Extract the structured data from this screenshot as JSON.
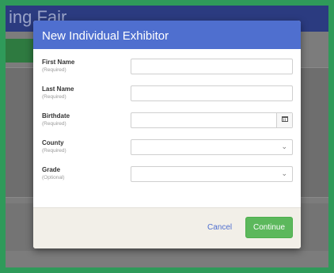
{
  "background": {
    "title_fragment": "ing Fair"
  },
  "modal": {
    "title": "New Individual Exhibitor",
    "fields": [
      {
        "label": "First Name",
        "note": "(Required)",
        "type": "text",
        "value": ""
      },
      {
        "label": "Last Name",
        "note": "(Required)",
        "type": "text",
        "value": ""
      },
      {
        "label": "Birthdate",
        "note": "(Required)",
        "type": "date",
        "value": ""
      },
      {
        "label": "County",
        "note": "(Required)",
        "type": "select",
        "value": ""
      },
      {
        "label": "Grade",
        "note": "(Optional)",
        "type": "select",
        "value": ""
      }
    ],
    "footer": {
      "cancel_label": "Cancel",
      "continue_label": "Continue"
    }
  },
  "icons": {
    "calendar": "calendar-icon",
    "chevron": "chevron-down-icon"
  },
  "colors": {
    "frame": "#2f9a5a",
    "header": "#4f6fcf",
    "continue": "#5cb85c",
    "link": "#4f6fcf"
  }
}
